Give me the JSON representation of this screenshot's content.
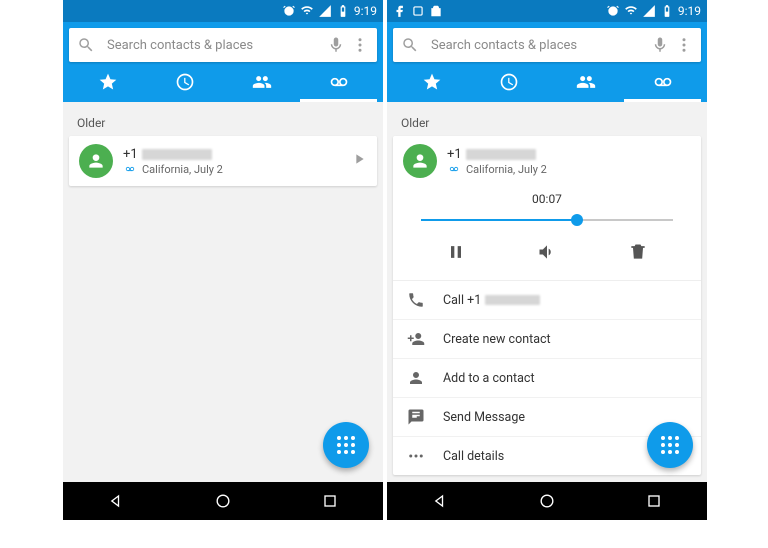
{
  "status": {
    "time": "9:19"
  },
  "search": {
    "placeholder": "Search contacts & places"
  },
  "section_label": "Older",
  "voicemail": {
    "prefix": "+1",
    "location_date": "California, July 2",
    "elapsed": "00:07",
    "progress_pct": 62
  },
  "menu": {
    "call": "Call +1",
    "create": "Create new contact",
    "add": "Add to a contact",
    "send": "Send Message",
    "details": "Call details"
  }
}
